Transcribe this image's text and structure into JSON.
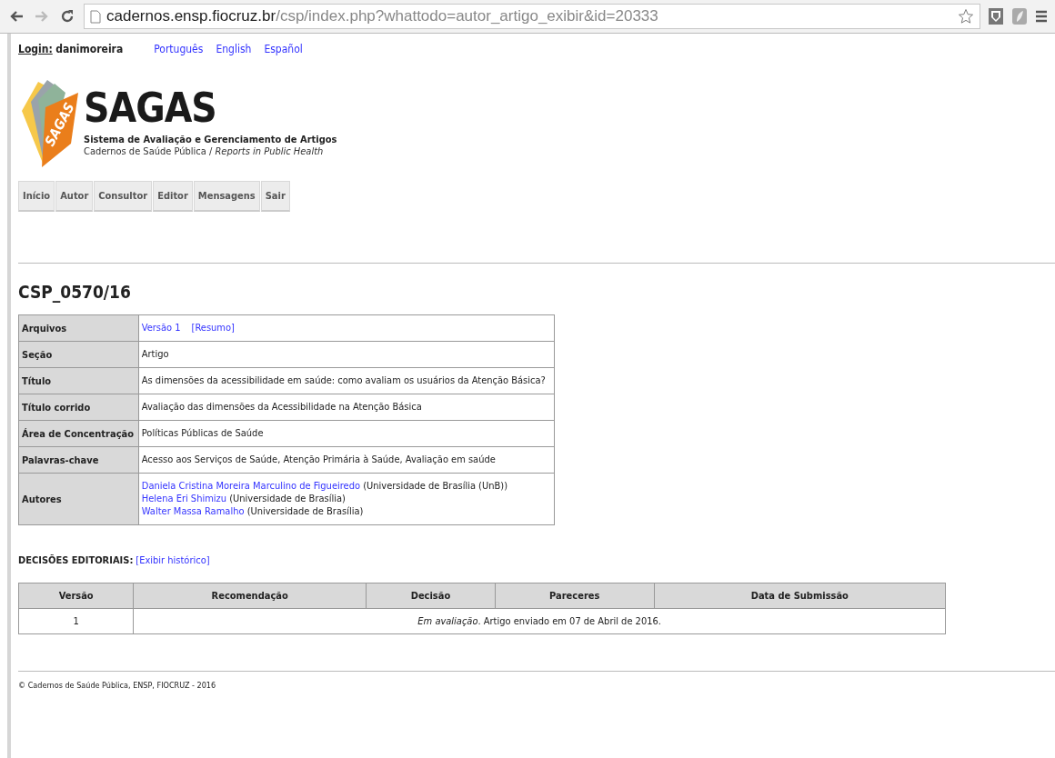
{
  "browser": {
    "buttons": [
      {
        "kind": "back",
        "disabled": false
      },
      {
        "kind": "forward",
        "disabled": true
      },
      {
        "kind": "reload",
        "disabled": false
      }
    ],
    "url_host": "cadernos.ensp.fiocruz.br",
    "url_path": "/csp/index.php?whattodo=autor_artigo_exibir&id=20333"
  },
  "login": {
    "label": "Login:",
    "user": "danimoreira"
  },
  "languages": [
    "Português",
    "English",
    "Español"
  ],
  "logo": {
    "emblem_text": "SAGAS",
    "name": "SAGAS",
    "subtitle": "Sistema de Avaliação e Gerenciamento de Artigos",
    "journal": "Cadernos de Saúde Pública / *Reports in Public Health*"
  },
  "nav": [
    "Início",
    "Autor",
    "Consultor",
    "Editor",
    "Mensagens",
    "Sair"
  ],
  "article_id": "CSP_0570/16",
  "details": [
    {
      "kind": "links",
      "label": "Arquivos",
      "links": [
        "Versão 1",
        "[Resumo]"
      ]
    },
    {
      "kind": "text",
      "label": "Seção",
      "value": "Artigo"
    },
    {
      "kind": "text",
      "label": "Título",
      "value": "As dimensões da acessibilidade em saúde: como avaliam os usuários da Atenção Básica?"
    },
    {
      "kind": "text",
      "label": "Título corrido",
      "value": "Avaliação das dimensões da Acessibilidade na Atenção Básica"
    },
    {
      "kind": "text",
      "label": "Área de Concentração",
      "value": "Políticas Públicas de Saúde"
    },
    {
      "kind": "text",
      "label": "Palavras-chave",
      "value": "Acesso aos Serviços de Saúde, Atenção Primária à Saúde, Avaliação em saúde"
    },
    {
      "kind": "authors",
      "label": "Autores",
      "authors": [
        {
          "name": "Daniela Cristina Moreira Marculino de Figueiredo",
          "affiliation": "(Universidade de Brasília (UnB))"
        },
        {
          "name": "Helena Eri Shimizu",
          "affiliation": "(Universidade de Brasília)"
        },
        {
          "name": "Walter Massa Ramalho",
          "affiliation": "(Universidade de Brasília)"
        }
      ]
    }
  ],
  "decisions": {
    "label": "DECISÕES EDITORIAIS:",
    "history_link": "[Exibir histórico]",
    "columns": [
      "Versão",
      "Recomendação",
      "Decisão",
      "Pareceres",
      "Data de Submissão"
    ],
    "rows": [
      {
        "version": "1",
        "status": "*Em avaliação*. Artigo enviado em 07 de Abril de 2016."
      }
    ]
  },
  "footer": "© Cadernos de Saúde Pública, ENSP, FIOCRUZ - 2016"
}
